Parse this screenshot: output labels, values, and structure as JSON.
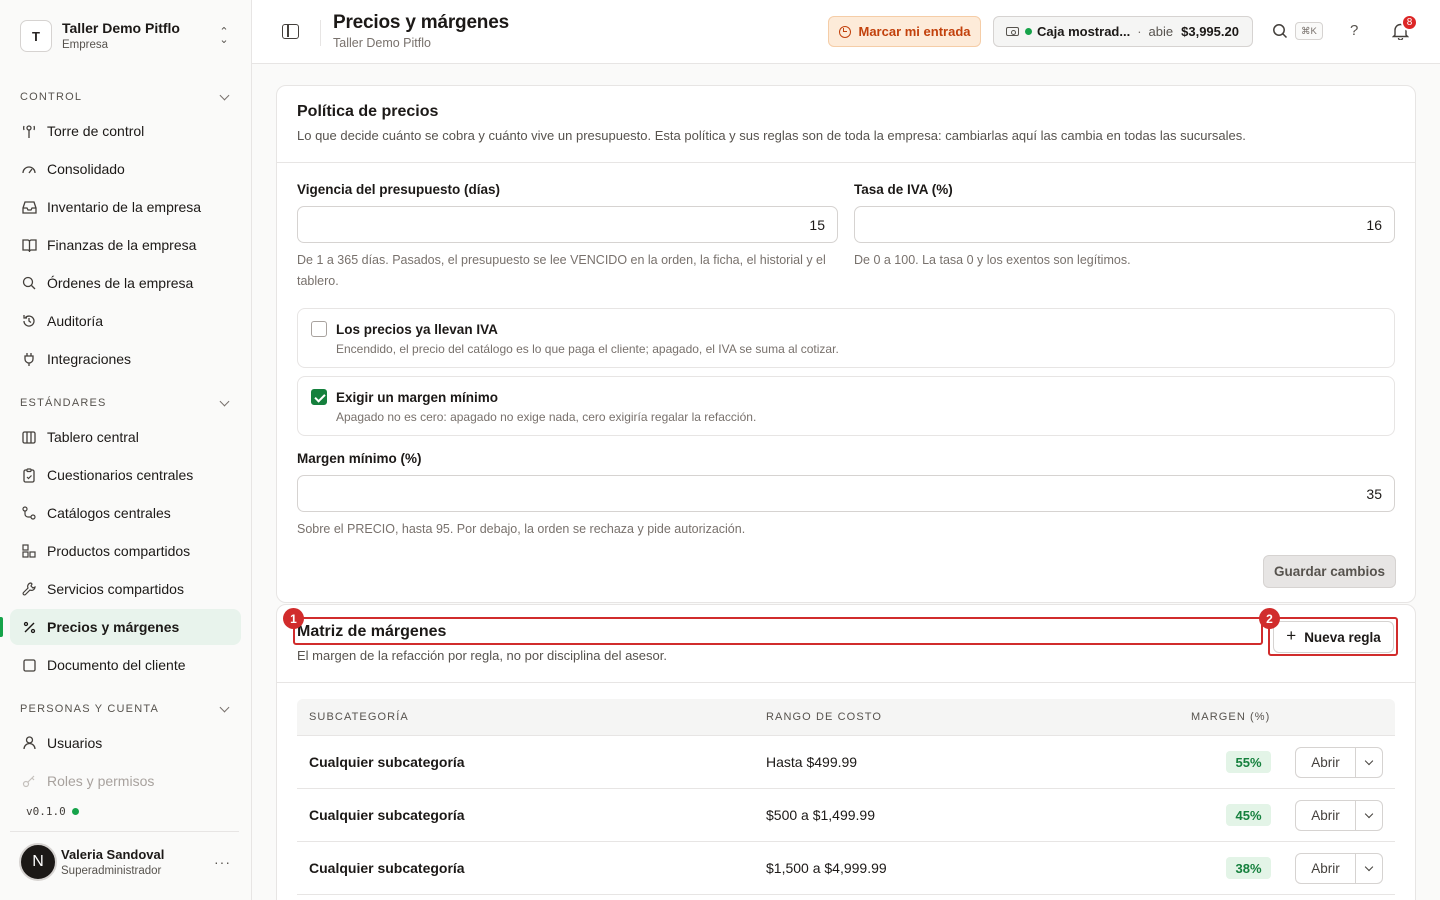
{
  "org": {
    "initial": "T",
    "name": "Taller Demo Pitflo",
    "type": "Empresa"
  },
  "sidebar": {
    "sections": [
      {
        "label": "CONTROL",
        "items": [
          {
            "label": "Torre de control",
            "icon": "tower-icon"
          },
          {
            "label": "Consolidado",
            "icon": "gauge-icon"
          },
          {
            "label": "Inventario de la empresa",
            "icon": "inbox-icon"
          },
          {
            "label": "Finanzas de la empresa",
            "icon": "book-icon"
          },
          {
            "label": "Órdenes de la empresa",
            "icon": "search-icon"
          },
          {
            "label": "Auditoría",
            "icon": "history-icon"
          },
          {
            "label": "Integraciones",
            "icon": "plug-icon"
          }
        ]
      },
      {
        "label": "ESTÁNDARES",
        "items": [
          {
            "label": "Tablero central",
            "icon": "columns-icon"
          },
          {
            "label": "Cuestionarios centrales",
            "icon": "clipboard-icon"
          },
          {
            "label": "Catálogos centrales",
            "icon": "route-icon"
          },
          {
            "label": "Productos compartidos",
            "icon": "boxes-icon"
          },
          {
            "label": "Servicios compartidos",
            "icon": "wrench-icon"
          },
          {
            "label": "Precios y márgenes",
            "icon": "percent-icon",
            "active": true
          },
          {
            "label": "Documento del cliente",
            "icon": "document-icon"
          }
        ]
      },
      {
        "label": "PERSONAS Y CUENTA",
        "items": [
          {
            "label": "Usuarios",
            "icon": "user-icon"
          },
          {
            "label": "Roles y permisos",
            "icon": "key-icon",
            "faded": true
          }
        ]
      }
    ],
    "version": "v0.1.0",
    "user": {
      "initial": "N",
      "name": "Valeria Sandoval",
      "role": "Superadministrador",
      "more": "···"
    }
  },
  "header": {
    "title": "Precios y márgenes",
    "subtitle": "Taller Demo Pitflo",
    "clock_in_label": "Marcar mi entrada",
    "cashbox": {
      "name": "Caja mostrad...",
      "separator": "·",
      "state": "abie",
      "amount": "$3,995.20"
    },
    "shortcut": "⌘K",
    "help": "?",
    "notifications_count": "8"
  },
  "pricing_policy": {
    "title": "Política de precios",
    "description": "Lo que decide cuánto se cobra y cuánto vive un presupuesto. Esta política y sus reglas son de toda la empresa: cambiarlas aquí las cambia en todas las sucursales.",
    "validity": {
      "label": "Vigencia del presupuesto (días)",
      "value": "15",
      "help": "De 1 a 365 días. Pasados, el presupuesto se lee VENCIDO en la orden, la ficha, el historial y el tablero."
    },
    "vat": {
      "label": "Tasa de IVA (%)",
      "value": "16",
      "help": "De 0 a 100. La tasa 0 y los exentos son legítimos."
    },
    "prices_include_vat": {
      "label": "Los precios ya llevan IVA",
      "description": "Encendido, el precio del catálogo es lo que paga el cliente; apagado, el IVA se suma al cotizar.",
      "checked": false
    },
    "require_min_margin": {
      "label": "Exigir un margen mínimo",
      "description": "Apagado no es cero: apagado no exige nada, cero exigiría regalar la refacción.",
      "checked": true
    },
    "min_margin": {
      "label": "Margen mínimo (%)",
      "value": "35",
      "help": "Sobre el PRECIO, hasta 95. Por debajo, la orden se rechaza y pide autorización."
    },
    "save_label": "Guardar cambios"
  },
  "margin_matrix": {
    "title": "Matriz de márgenes",
    "description": "El margen de la refacción por regla, no por disciplina del asesor.",
    "new_rule_label": "Nueva regla",
    "annotations": [
      "1",
      "2"
    ],
    "columns": [
      "SUBCATEGORÍA",
      "RANGO DE COSTO",
      "MARGEN (%)"
    ],
    "rows": [
      {
        "subcategory": "Cualquier subcategoría",
        "cost_range": "Hasta $499.99",
        "margin": "55%",
        "action": "Abrir"
      },
      {
        "subcategory": "Cualquier subcategoría",
        "cost_range": "$500 a $1,499.99",
        "margin": "45%",
        "action": "Abrir"
      },
      {
        "subcategory": "Cualquier subcategoría",
        "cost_range": "$1,500 a $4,999.99",
        "margin": "38%",
        "action": "Abrir"
      }
    ]
  },
  "colors": {
    "accent": "#16a34a",
    "highlight": "#d12c2c",
    "warning": "#c2410c"
  }
}
